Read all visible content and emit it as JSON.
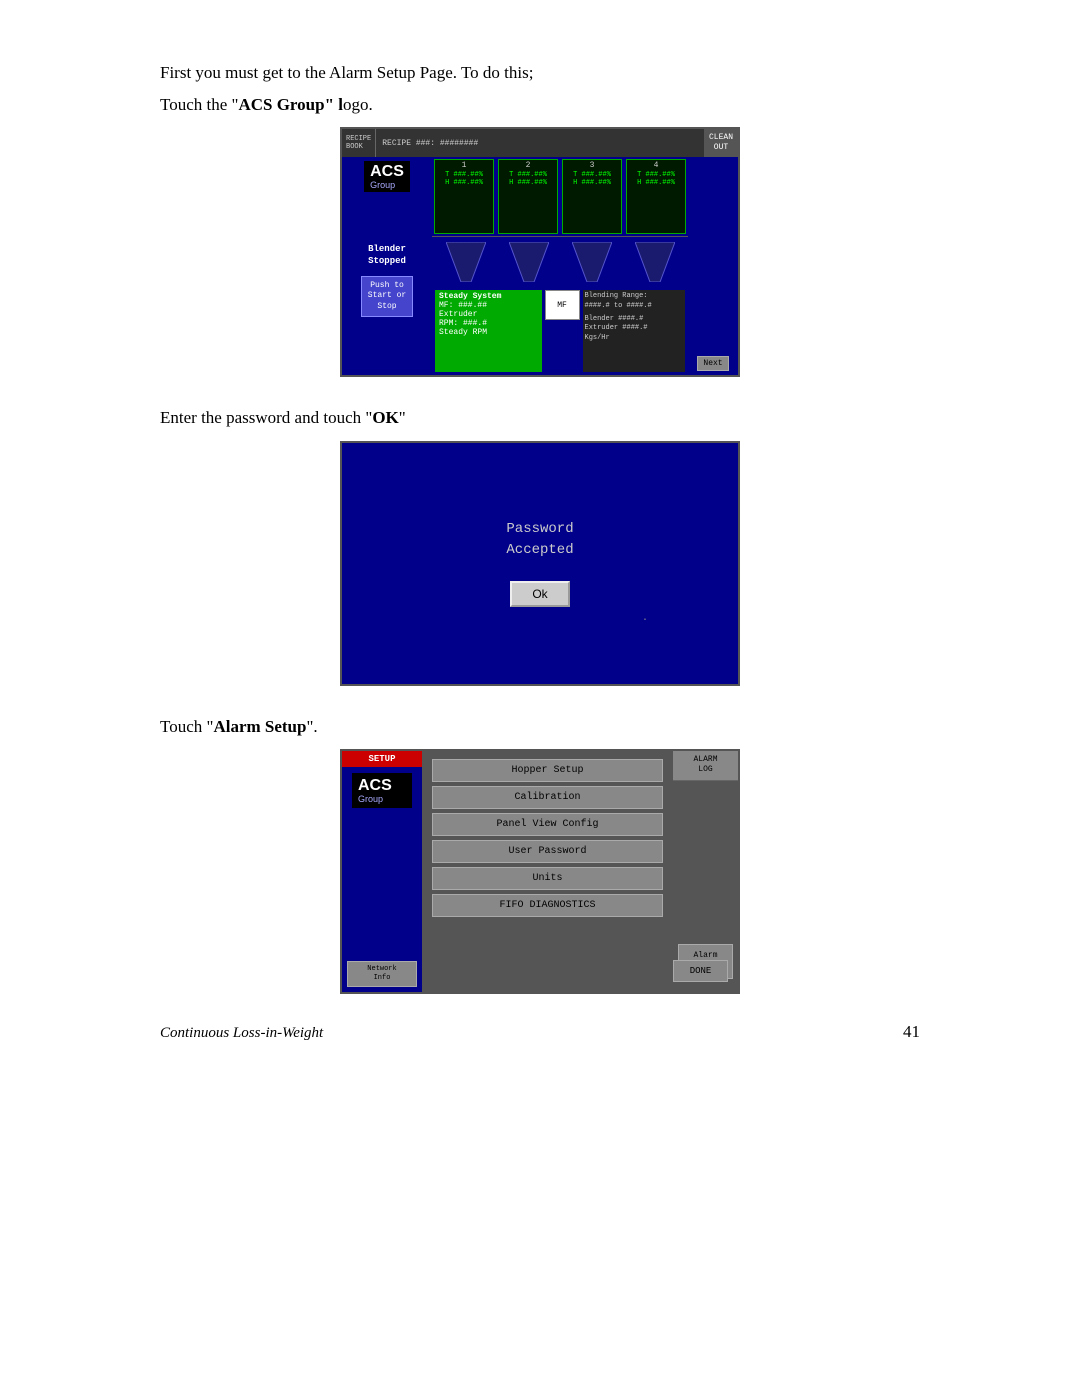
{
  "page": {
    "background": "#ffffff",
    "intro_line1": "First you must get to the Alarm Setup Page.  To do this;",
    "intro_line2": "Touch the “ACS Group” logo.",
    "screen2_intro": "Enter the password and touch “OK”",
    "screen3_intro": "Touch “Alarm Setup”.",
    "footer_text": "Continuous Loss-in-Weight",
    "footer_page": "41"
  },
  "screen1": {
    "recipe_book": "RECIPE\nBOOK",
    "recipe_label": "RECIPE ###:",
    "recipe_value": "########",
    "clean_out": "CLEAN\nOUT",
    "logo_acs": "ACS",
    "logo_group": "Group",
    "hopper1": "1",
    "hopper2": "2",
    "hopper3": "3",
    "hopper4": "4",
    "hopper_t_val": "T ###.##%",
    "hopper_h_val": "H ###.##%",
    "blender_stopped": "Blender\nStopped",
    "push_to": "Push to\nStart or\nStop",
    "steady_system": "Steady System",
    "mf_label": "MF: ###.##",
    "extruder_label": "Extruder",
    "rpm_label": "RPM:   ###.#",
    "steady_rpm": "Steady RPM",
    "mf_box": "MF",
    "blending_range": "Blending Range:",
    "blending_vals": "####.# to ####.#",
    "blender_val": "Blender ####.#",
    "extruder_val": "Extruder ####.#",
    "kgs_hr": "Kgs/Hr",
    "next_btn": "Next"
  },
  "screen2": {
    "password_accepted": "Password\nAccepted",
    "ok_btn": "Ok"
  },
  "screen3": {
    "setup_label": "SETUP",
    "logo_acs": "ACS",
    "logo_group": "Group",
    "alarm_log": "ALARM\nLOG",
    "hopper_setup": "Hopper Setup",
    "calibration": "Calibration",
    "panel_view_config": "Panel View Config",
    "user_password": "User Password",
    "units": "Units",
    "fifo_diagnostics": "FIFO DIAGNOSTICS",
    "alarm_setup": "Alarm\nSetup",
    "network_info": "Network\nInfo",
    "done_btn": "DONE"
  }
}
